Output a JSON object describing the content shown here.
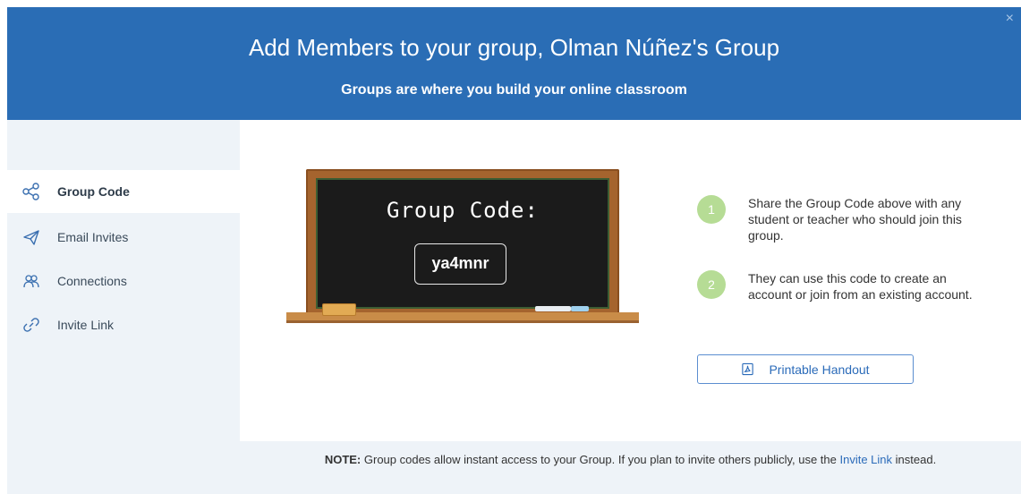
{
  "header": {
    "title": "Add Members to your group, Olman Núñez's Group",
    "subtitle": "Groups are where you build your online classroom",
    "close_symbol": "×"
  },
  "sidebar": {
    "items": [
      {
        "label": "Group Code",
        "icon": "share-nodes-icon",
        "active": true
      },
      {
        "label": "Email Invites",
        "icon": "paper-plane-icon",
        "active": false
      },
      {
        "label": "Connections",
        "icon": "connections-people-icon",
        "active": false
      },
      {
        "label": "Invite Link",
        "icon": "link-icon",
        "active": false
      }
    ]
  },
  "board": {
    "title": "Group Code:",
    "code": "ya4mnr"
  },
  "steps": [
    {
      "number": "1",
      "text": "Share the Group Code above with any student or teacher who should join this group."
    },
    {
      "number": "2",
      "text": "They can use this code to create an account or join from an existing account."
    }
  ],
  "handout_button": {
    "label": "Printable Handout",
    "icon": "pdf-icon"
  },
  "note": {
    "prefix": "NOTE:",
    "text_before": " Group codes allow instant access to your Group. If you plan to invite others publicly, use the ",
    "link": "Invite Link",
    "text_after": " instead."
  },
  "colors": {
    "header_bg": "#2a6db5",
    "sidebar_bg": "#eef3f8",
    "accent": "#2b6bb9",
    "step_badge": "#b6dc95"
  }
}
